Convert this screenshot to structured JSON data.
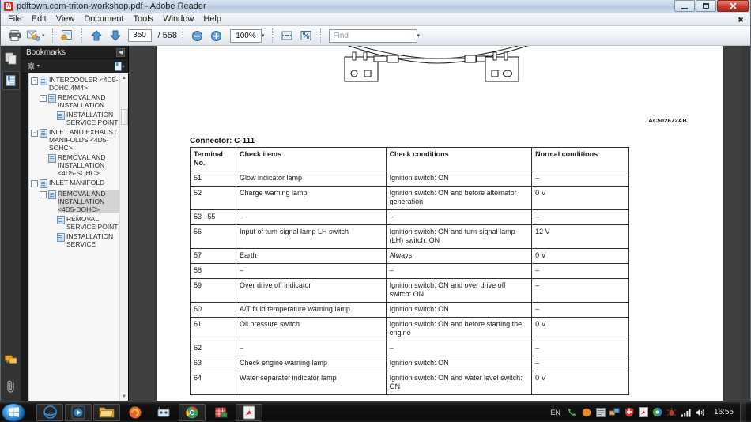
{
  "window": {
    "title": "pdftown.com-triton-workshop.pdf - Adobe Reader",
    "app_icon": "pdf-icon",
    "minimize_label": "Minimize",
    "maximize_label": "Maximize",
    "close_label": "Close",
    "document_close_label": "✖"
  },
  "menubar": {
    "items": [
      {
        "label": "File"
      },
      {
        "label": "Edit"
      },
      {
        "label": "View"
      },
      {
        "label": "Document"
      },
      {
        "label": "Tools"
      },
      {
        "label": "Window"
      },
      {
        "label": "Help"
      }
    ]
  },
  "toolbar": {
    "print_icon": "printer-icon",
    "email_icon": "attach-email-icon",
    "email_caret": "▾",
    "snapshot_icon": "page-globe-icon",
    "prev_page_icon": "arrow-up-icon",
    "next_page_icon": "arrow-down-icon",
    "page_number": "350",
    "page_total": "/ 558",
    "zoom_out_icon": "zoom-out-icon",
    "zoom_in_icon": "zoom-in-icon",
    "zoom_level": "100%",
    "zoom_caret": "▾",
    "fit_width_icon": "fit-width-icon",
    "fit_page_icon": "fit-page-icon",
    "find_placeholder": "Find",
    "find_value": "",
    "find_caret": "▾"
  },
  "navigation_rail": {
    "pages_icon": "page-thumbnails-icon",
    "bookmarks_icon": "bookmarks-icon",
    "comments_icon": "comment-bubbles-icon",
    "attachments_icon": "paperclip-icon"
  },
  "bookmarks_panel": {
    "title": "Bookmarks",
    "collapse_icon": "collapse-left-icon",
    "options_icon": "gear-icon",
    "options_caret": "▾",
    "expand_current_icon": "expand-bookmark-icon",
    "scroll_up_icon": "▲",
    "scroll_down_icon": "▼",
    "tree": [
      {
        "label": "INTERCOOLER <4D5-DOHC,4M4>",
        "indent": 0,
        "expander": "-",
        "selected": false
      },
      {
        "label": "REMOVAL AND INSTALLATION",
        "indent": 1,
        "expander": "-",
        "selected": false
      },
      {
        "label": "INSTALLATION SERVICE POINT",
        "indent": 2,
        "expander": "",
        "selected": false
      },
      {
        "label": "INLET AND EXHAUST MANIFOLDS <4D5-SOHC>",
        "indent": 0,
        "expander": "-",
        "selected": false
      },
      {
        "label": "REMOVAL AND INSTALLATION <4D5-SOHC>",
        "indent": 1,
        "expander": "",
        "selected": false
      },
      {
        "label": "INLET MANIFOLD",
        "indent": 0,
        "expander": "-",
        "selected": false
      },
      {
        "label": "REMOVAL AND INSTALLATION <4D5-DOHC>",
        "indent": 1,
        "expander": "-",
        "selected": true
      },
      {
        "label": "REMOVAL SERVICE POINT",
        "indent": 2,
        "expander": "",
        "selected": false
      },
      {
        "label": "INSTALLATION SERVICE",
        "indent": 2,
        "expander": "",
        "selected": false
      }
    ]
  },
  "document": {
    "figure_code": "AC502672AB",
    "connector_title": "Connector: C-111",
    "table": {
      "headers": [
        "Terminal No.",
        "Check items",
        "Check conditions",
        "Normal conditions"
      ],
      "rows": [
        [
          "51",
          "Glow indicator lamp",
          "Ignition switch: ON",
          "–"
        ],
        [
          "52",
          "Charge warning lamp",
          "Ignition switch: ON and before alternator generation",
          "0 V"
        ],
        [
          "53 –55",
          "–",
          "–",
          "–"
        ],
        [
          "56",
          "Input of turn-signal lamp LH switch",
          "Ignition switch: ON and turn-signal lamp (LH) switch: ON",
          "12 V"
        ],
        [
          "57",
          "Earth",
          "Always",
          "0 V"
        ],
        [
          "58",
          "–",
          "–",
          "–"
        ],
        [
          "59",
          "Over drive off indicator",
          "Ignition switch: ON and over drive off switch: ON",
          "–"
        ],
        [
          "60",
          "A/T fluid temperature warning lamp",
          "Ignition switch: ON",
          "–"
        ],
        [
          "61",
          "Oil pressure switch",
          "Ignition switch: ON and before starting the engine",
          "0 V"
        ],
        [
          "62",
          "–",
          "–",
          "–"
        ],
        [
          "63",
          "Check engine warning lamp",
          "Ignition switch: ON",
          "–"
        ],
        [
          "64",
          "Water separater indicator lamp",
          "Ignition switch: ON and water level switch: ON",
          "0 V"
        ]
      ]
    }
  },
  "taskbar": {
    "start_label": "Start",
    "items": [
      {
        "name": "internet-explorer-icon",
        "label": "Internet Explorer"
      },
      {
        "name": "media-player-icon",
        "label": "Windows Media Player"
      },
      {
        "name": "file-explorer-icon",
        "label": "Windows Explorer"
      },
      {
        "name": "firefox-icon",
        "label": "Mozilla Firefox"
      },
      {
        "name": "utility-icon",
        "label": "Utility"
      },
      {
        "name": "chrome-icon",
        "label": "Google Chrome"
      },
      {
        "name": "spreadsheet-icon",
        "label": "Spreadsheet"
      },
      {
        "name": "adobe-reader-icon",
        "label": "Adobe Reader"
      }
    ],
    "tray": {
      "language": "EN",
      "icons": [
        "phone-icon",
        "orange-sphere-icon",
        "window-icon",
        "network-icon",
        "shield-icon",
        "pdf-tray-icon",
        "globe-icon",
        "antivirus-icon",
        "signal-icon",
        "volume-icon"
      ]
    },
    "clock": "16:55"
  }
}
